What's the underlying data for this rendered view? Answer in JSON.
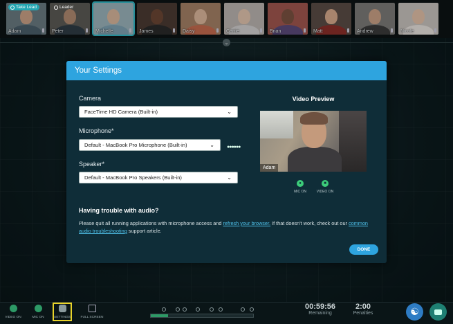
{
  "participants": [
    {
      "name": "Adam",
      "badge": "Take Lead",
      "skin": "#c9a186",
      "shirt": "#4a5e6a",
      "bg": "#6a7a80"
    },
    {
      "name": "Peter",
      "badge": "Leader",
      "skin": "#b08a70",
      "shirt": "#2f3b45",
      "bg": "#5c5a55"
    },
    {
      "name": "Michelle",
      "badge": "",
      "skin": "#d7b59c",
      "shirt": "#7ea1b1",
      "bg": "#9ab3ba",
      "active": true
    },
    {
      "name": "James",
      "badge": "",
      "skin": "#6b4634",
      "shirt": "#2a2a2a",
      "bg": "#4b3a32"
    },
    {
      "name": "Daisy",
      "badge": "",
      "skin": "#dcb79b",
      "shirt": "#c46b4f",
      "bg": "#a58066"
    },
    {
      "name": "Carrie",
      "badge": "",
      "skin": "#e1c3ad",
      "shirt": "#d1cfcf",
      "bg": "#bab4b0"
    },
    {
      "name": "Brian",
      "badge": "",
      "skin": "#7a5140",
      "shirt": "#5b4a7a",
      "bg": "#a0574f"
    },
    {
      "name": "Matt",
      "badge": "",
      "skin": "#d6a98c",
      "shirt": "#8b2f2a",
      "bg": "#5a4c46"
    },
    {
      "name": "Andrew",
      "badge": "",
      "skin": "#caa186",
      "shirt": "#3a3a3a",
      "bg": "#7b7a78"
    },
    {
      "name": "Nicole",
      "badge": "",
      "skin": "#e0bfa7",
      "shirt": "#e6e0dc",
      "bg": "#c7c2bd"
    }
  ],
  "dialog": {
    "title": "Your Settings",
    "camera_label": "Camera",
    "camera_value": "FaceTime HD Camera (Built-in)",
    "microphone_label": "Microphone*",
    "microphone_value": "Default - MacBook Pro Microphone (Built-in)",
    "speaker_label": "Speaker*",
    "speaker_value": "Default - MacBook Pro Speakers (Built-in)",
    "preview_title": "Video Preview",
    "preview_name": "Adam",
    "mic_on": "MIC ON",
    "video_on": "VIDEO ON",
    "trouble_title": "Having trouble with audio?",
    "help_text_1": "Please quit all running applications with microphone access and ",
    "help_link_1": "refresh your browser.",
    "help_text_2": " If that doesn't work, check out our ",
    "help_link_2": "common audio troubleshooting",
    "help_text_3": " support article.",
    "done_label": "DONE"
  },
  "bottom_bar": {
    "video_on": "VIDEO ON",
    "mic_on": "MIC ON",
    "settings": "SETTINGS",
    "full_screen": "FULL SCREEN",
    "timer_value": "00:59:56",
    "timer_label": "Remaining",
    "penalties_value": "2:00",
    "penalties_label": "Penalties",
    "progress_fraction": 0.17
  },
  "colors": {
    "accent": "#2ea4df",
    "green": "#3ccc7a",
    "highlight": "#e8d32a"
  }
}
